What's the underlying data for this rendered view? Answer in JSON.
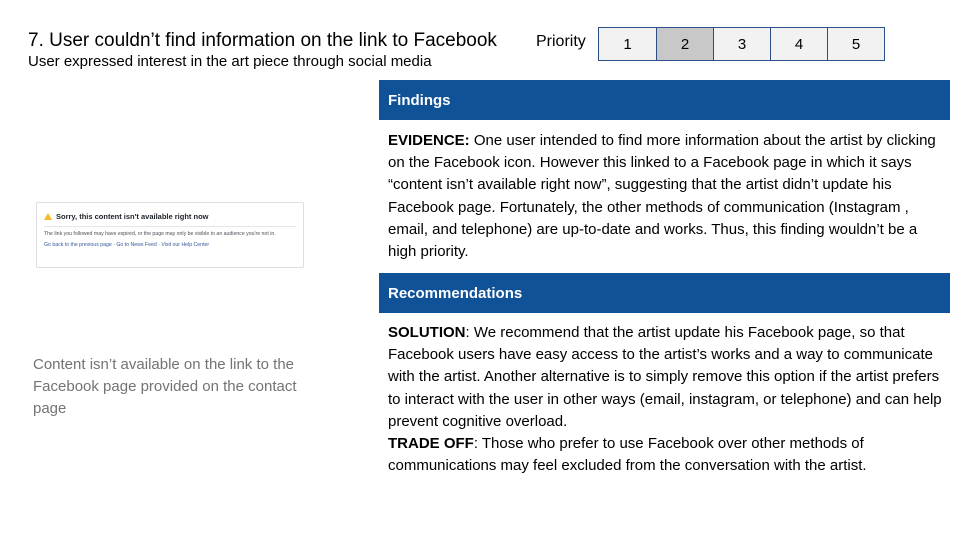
{
  "header": {
    "title": "7. User couldn’t find information on the link to Facebook",
    "subtitle": "User expressed interest in the art piece through social media"
  },
  "priority": {
    "label": "Priority",
    "levels": [
      "1",
      "2",
      "3",
      "4",
      "5"
    ],
    "selected": "2"
  },
  "screenshot": {
    "heading": "Sorry, this content isn't available right now",
    "body": "The link you followed may have expired, or the page may only be visible to an audience you're not in.",
    "links": "Go back to the previous page · Go to News Feed · Visit our Help Center",
    "icon": "warning-icon"
  },
  "caption": "Content isn’t available on the link to the Facebook page provided on the contact page",
  "findings": {
    "heading": "Findings",
    "evidence_label": "EVIDENCE:",
    "evidence_text": " One user intended to find more information about the artist by clicking on the Facebook icon. However this linked to a Facebook page in which it says “content isn’t available right now”, suggesting that the artist didn’t update his Facebook page. Fortunately, the other methods of communication (Instagram , email, and telephone) are up-to-date and works. Thus, this finding wouldn’t  be a high priority."
  },
  "recommendations": {
    "heading": "Recommendations",
    "solution_label": "SOLUTION",
    "solution_text": ":  We recommend that the artist update his Facebook page, so that Facebook users have easy access to the artist’s works and a way to communicate with the artist. Another alternative is to simply remove this option if the artist prefers to interact with the user in other ways (email, instagram, or telephone) and can help prevent cognitive overload.",
    "tradeoff_label": "TRADE OFF",
    "tradeoff_text": ": Those who prefer to use Facebook over other methods of communications may feel excluded from the conversation with the artist."
  },
  "colors": {
    "section_bar": "#0f5298",
    "priority_selected": "#c8c8c8",
    "caption": "#737373"
  }
}
